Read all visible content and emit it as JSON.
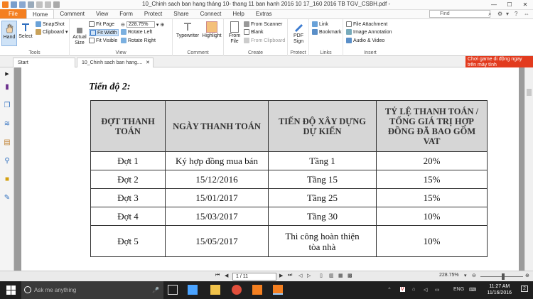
{
  "window": {
    "title": "10_Chinh sach ban hang tháng 10- thang 11 ban hanh 2016 10 17_160 2016 TB TGV_CSBH.pdf - Foxit Reader",
    "controls": {
      "minimize": "—",
      "maximize": "☐",
      "close": "✕"
    }
  },
  "menu": {
    "file": "File",
    "tabs": [
      "Home",
      "Comment",
      "View",
      "Form",
      "Protect",
      "Share",
      "Connect",
      "Help",
      "Extras"
    ],
    "find_placeholder": "Find"
  },
  "ribbon": {
    "tools": {
      "hand": "Hand",
      "select": "Select",
      "snapshot": "SnapShot",
      "clipboard": "Clipboard",
      "label": "Tools"
    },
    "view": {
      "actual_size": "Actual Size",
      "fit_page": "Fit Page",
      "fit_width": "Fit Width",
      "fit_visible": "Fit Visible",
      "zoom": "228.75%",
      "rotate_left": "Rotate Left",
      "rotate_right": "Rotate Right",
      "label": "View"
    },
    "comment": {
      "typewriter": "Typewriter",
      "highlight": "Highlight",
      "label": "Comment"
    },
    "create": {
      "from_file": "From File",
      "from_scanner": "From Scanner",
      "blank": "Blank",
      "from_clipboard": "From Clipboard",
      "label": "Create"
    },
    "protect": {
      "pdf_sign": "PDF Sign",
      "label": "Protect"
    },
    "links": {
      "link": "Link",
      "bookmark": "Bookmark",
      "label": "Links"
    },
    "insert": {
      "file_attachment": "File Attachment",
      "image_annotation": "Image Annotation",
      "audio_video": "Audio & Video",
      "label": "Insert"
    }
  },
  "tabs": {
    "start": "Start",
    "doc": "10_Chinh sach ban hang...."
  },
  "ad": {
    "text": "Chơi game di động ngay trên máy tính"
  },
  "document": {
    "heading": "Tiến độ 2:",
    "columns": [
      "ĐỢT THANH TOÁN",
      "NGÀY THANH TOÁN",
      "TIẾN ĐỘ XÂY DỰNG DỰ KIẾN",
      "TỶ LỆ THANH TOÁN / TỔNG GIÁ TRỊ HỢP ĐỒNG ĐÃ BAO GỒM VAT"
    ],
    "rows": [
      [
        "Đợt 1",
        "Ký hợp đồng mua bán",
        "Tầng 1",
        "20%"
      ],
      [
        "Đợt 2",
        "15/12/2016",
        "Tầng 15",
        "15%"
      ],
      [
        "Đợt 3",
        "15/01/2017",
        "Tầng 25",
        "15%"
      ],
      [
        "Đợt 4",
        "15/03/2017",
        "Tầng 30",
        "10%"
      ],
      [
        "Đợt 5",
        "15/05/2017",
        "Thi công hoàn thiện tòa nhà",
        "10%"
      ]
    ]
  },
  "statusbar": {
    "page": "1 / 11",
    "zoom": "228.75%"
  },
  "taskbar": {
    "search": "Ask me anything",
    "time": "11:27 AM",
    "date": "11/16/2016",
    "lang": "ENG",
    "notif": "2"
  }
}
